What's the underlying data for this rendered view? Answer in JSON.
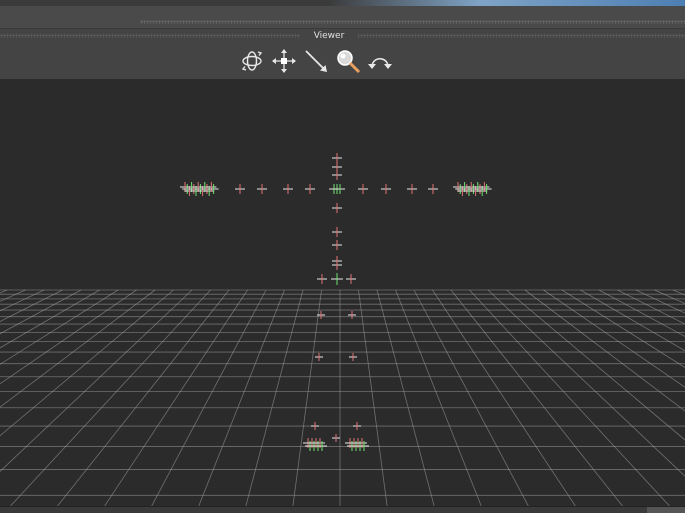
{
  "viewer": {
    "title": "Viewer",
    "tools": [
      {
        "name": "orbit-icon",
        "label": ""
      },
      {
        "name": "pan-icon",
        "label": ""
      },
      {
        "name": "dolly-icon",
        "label": ""
      },
      {
        "name": "zoom-icon",
        "label": ""
      },
      {
        "name": "undo-view-icon",
        "label": ""
      }
    ]
  },
  "colors": {
    "background": "#2b2b2b",
    "grid": "#a8a8a8",
    "marker_red": "#e07070",
    "marker_green": "#6fe06f",
    "marker_white": "#e8e8e8"
  }
}
